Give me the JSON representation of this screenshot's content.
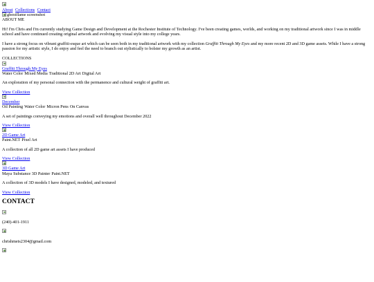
{
  "nav": {
    "about": "About",
    "collections": "Collections",
    "contact": "Contact"
  },
  "hero": {
    "alt": "ghostflame screenshot"
  },
  "about": {
    "title": "ABOUT ME",
    "para1": "Hi! I'm Chris and I'm currently studying Game Design and Development at the Rochester Institute of Technology. I've been creating games, worlds, and working on my traditional artwork since I was in middle school and have continued creating original artwork and evolving my visual style into my college years.",
    "para2_pre": "I have a strong focus on vibrant graffiti-esque art which can be seen both in my traditional artwork with my collection ",
    "para2_em": "Graffiti Through My Eyes",
    "para2_post": " and my more recent 2D and 3D game assets. While I have a strong passion for my artistic style, I do enjoy and feel the need to branch out stylistically to bolster my growth as an artist."
  },
  "collections": {
    "title": "COLLECTIONS",
    "items": [
      {
        "name": "Graffiti Through My Eyes",
        "tags": [
          "Water Color",
          "Mixed Media",
          "Traditional 2D Art",
          "Digital Art"
        ],
        "description": "An exploration of my personal connection with the permanence and cultural weight of graffiti art.",
        "link": "View Collection"
      },
      {
        "name": "December",
        "tags": [
          "Oil Painting",
          "Water Color",
          "Micron Pens",
          "On Canvas"
        ],
        "description": "A set of paintings conveying my emotions and overall well throughout December 2022",
        "link": "View Collection"
      },
      {
        "name": "2D Game Art",
        "tags": [
          "Paint.NET",
          "Pixel Art"
        ],
        "description": "A collection of all 2D game art assets I have produced",
        "link": "View Collection"
      },
      {
        "name": "3D Game Art",
        "tags": [
          "Maya",
          "Substance 3D Painter",
          "Paint.NET"
        ],
        "description": "A collection of 3D models I have designed, modeled, and textured",
        "link": "View Collection"
      }
    ]
  },
  "contact": {
    "title": "CONTACT",
    "phone": "(240)-401-1911",
    "email": "chrishmets2304@gmail.com"
  }
}
